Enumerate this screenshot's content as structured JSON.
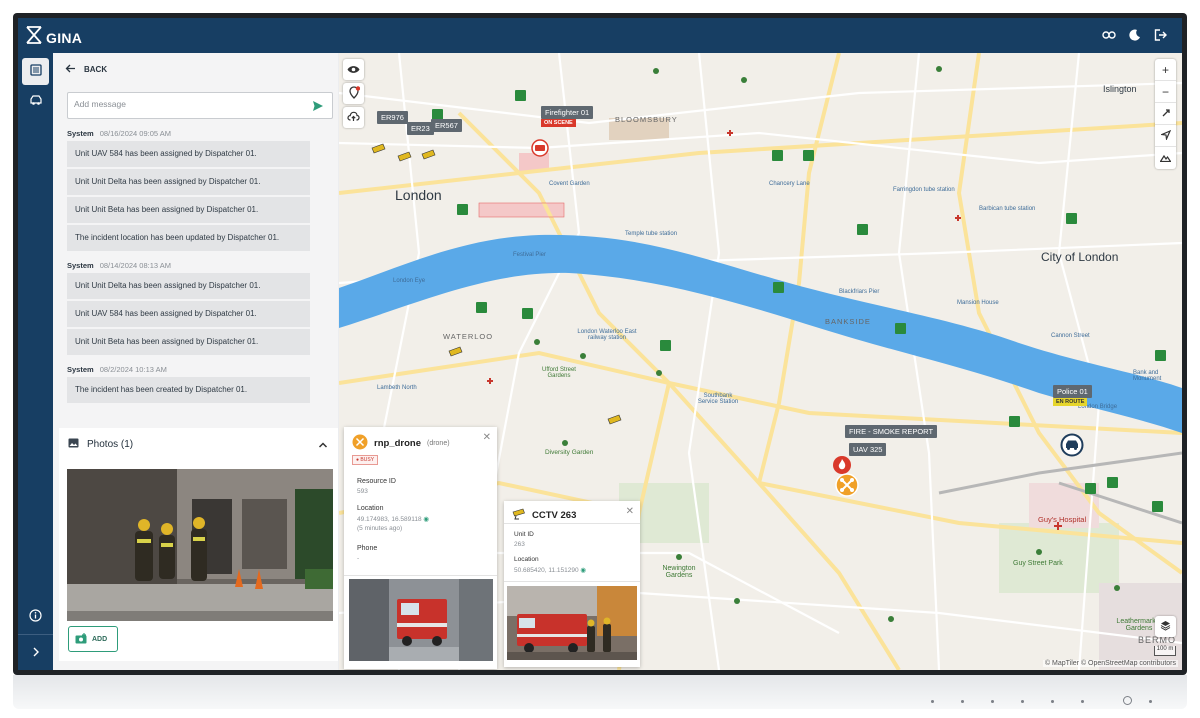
{
  "app": {
    "name": "GINA"
  },
  "topbar": {
    "icons": [
      "link-icon",
      "moon-icon",
      "logout-icon"
    ]
  },
  "rail": {
    "items": [
      "activity-log-icon",
      "vehicle-icon",
      "info-icon",
      "chevron-right-icon"
    ]
  },
  "panel": {
    "back_label": "BACK",
    "message_placeholder": "Add message",
    "groups": [
      {
        "author": "System",
        "timestamp": "08/16/2024 09:05 AM",
        "entries": [
          "Unit UAV 584 has been assigned by Dispatcher 01.",
          "Unit Unit Delta has been assigned by Dispatcher 01.",
          "Unit Unit Beta has been assigned by Dispatcher 01.",
          "The incident location has been updated by Dispatcher 01."
        ]
      },
      {
        "author": "System",
        "timestamp": "08/14/2024 08:13 AM",
        "entries": [
          "Unit Unit Delta has been assigned by Dispatcher 01.",
          "Unit UAV 584 has been assigned by Dispatcher 01.",
          "Unit Unit Beta has been assigned by Dispatcher 01."
        ]
      },
      {
        "author": "System",
        "timestamp": "08/2/2024 10:13 AM",
        "entries": [
          "The incident has been created by Dispatcher 01."
        ]
      }
    ],
    "photos": {
      "title": "Photos (1)",
      "add_label": "ADD"
    }
  },
  "map": {
    "labels": {
      "london": "London",
      "city_of_london": "City of London",
      "islington": "Islington",
      "waterloo": "WATERLOO",
      "bankside": "BANKSIDE",
      "bloomsbury": "BLOOMSBURY",
      "guys_hospital": "Guy's Hospital",
      "guy_street_park": "Guy Street Park",
      "newington_gardens": "Newington Gardens",
      "diversity_garden": "Diversity Garden",
      "leathermarket_gardens": "Leathermarket Gardens",
      "ufford_street_gardens": "Ufford Street Gardens",
      "southbank_service_station": "Southbank Service Station",
      "bermondsey": "BERMO",
      "london_bridge": "London Bridge",
      "cannon_street": "Cannon Street",
      "mansion_house": "Mansion House",
      "london_eye": "London Eye",
      "lambeth_north": "Lambeth North",
      "blackfriars_pier": "Blackfriars Pier",
      "festival_pier": "Festival Pier",
      "temple": "Temple tube station",
      "bank_monument": "Bank and Monument",
      "covent_garden": "Covent Garden",
      "chancery_lane": "Chancery Lane",
      "farringdon": "Farringdon tube station",
      "barbican": "Barbican tube station",
      "waterloo_east": "London Waterloo East railway station"
    },
    "markers": {
      "er_units": [
        "ER976",
        "ER23",
        "ER567"
      ],
      "firefighter": {
        "name": "Firefighter 01",
        "status": "ON SCENE"
      },
      "police": {
        "name": "Police 01",
        "status": "EN ROUTE"
      },
      "incident": "FIRE - SMOKE REPORT",
      "uav": "UAV 325"
    },
    "controls": [
      "eye-icon",
      "location-pin-icon",
      "cloud-upload-icon",
      "zoom-in-icon",
      "zoom-out-icon",
      "rotate-icon",
      "navigate-icon",
      "terrain-icon",
      "layers-icon"
    ],
    "scale_label": "100 m",
    "attribution": "© MapTiler © OpenStreetMap contributors"
  },
  "popups": {
    "drone": {
      "title": "rnp_drone",
      "subtitle": "(drone)",
      "status": "BUSY",
      "resource_id_label": "Resource ID",
      "resource_id": "593",
      "location_label": "Location",
      "location": "49.174983, 16.589118",
      "location_age": "(5 minutes ago)",
      "phone_label": "Phone",
      "phone": "-"
    },
    "cctv": {
      "title": "CCTV 263",
      "unit_id_label": "Unit ID",
      "unit_id": "263",
      "location_label": "Location",
      "location": "50.685420, 11.151290"
    }
  },
  "colors": {
    "topbar": "#173e63",
    "accent": "#2e9c7a",
    "water": "#5aa9e8",
    "park": "#cfe6c2",
    "incident": "#d9392b",
    "police": "#1f3d5c"
  }
}
